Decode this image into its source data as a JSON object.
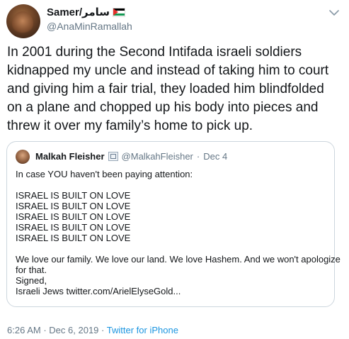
{
  "author": {
    "display_name": "Samer/سامر",
    "handle": "@AnaMinRamallah"
  },
  "tweet_lines": [
    "In 2001 during the Second Intifada israeli soldiers",
    "kidnapped my uncle and instead of taking him to court",
    "and giving him a fair trial, they loaded him blindfolded",
    "on a plane and chopped up his body into pieces and",
    "threw it over my family’s home to pick up."
  ],
  "quoted": {
    "display_name": "Malkah Fleisher",
    "handle": "@MalkahFleisher",
    "separator": "·",
    "date": "Dec 4",
    "lines": [
      "In case YOU haven't been paying attention:",
      "",
      "ISRAEL IS BUILT ON LOVE",
      "ISRAEL IS BUILT ON LOVE",
      "ISRAEL IS BUILT ON LOVE",
      "ISRAEL IS BUILT ON LOVE",
      "ISRAEL IS BUILT ON LOVE",
      "",
      "We love our family. We love our land. We love Hashem. And we won't apologize",
      "for that.",
      "Signed,",
      "Israeli Jews twitter.com/ArielElyseGold..."
    ]
  },
  "meta": {
    "time": "6:26 AM",
    "separator": "·",
    "date": "Dec 6, 2019",
    "separator2": "·",
    "source": "Twitter for iPhone"
  },
  "colors": {
    "text": "#14171a",
    "secondary": "#657786",
    "link": "#1b95e0",
    "border": "#ccd6dd"
  },
  "icons": {
    "flag": "palestine-flag-icon",
    "caret": "chevron-down-icon",
    "emblem": "government-emblem-icon"
  }
}
